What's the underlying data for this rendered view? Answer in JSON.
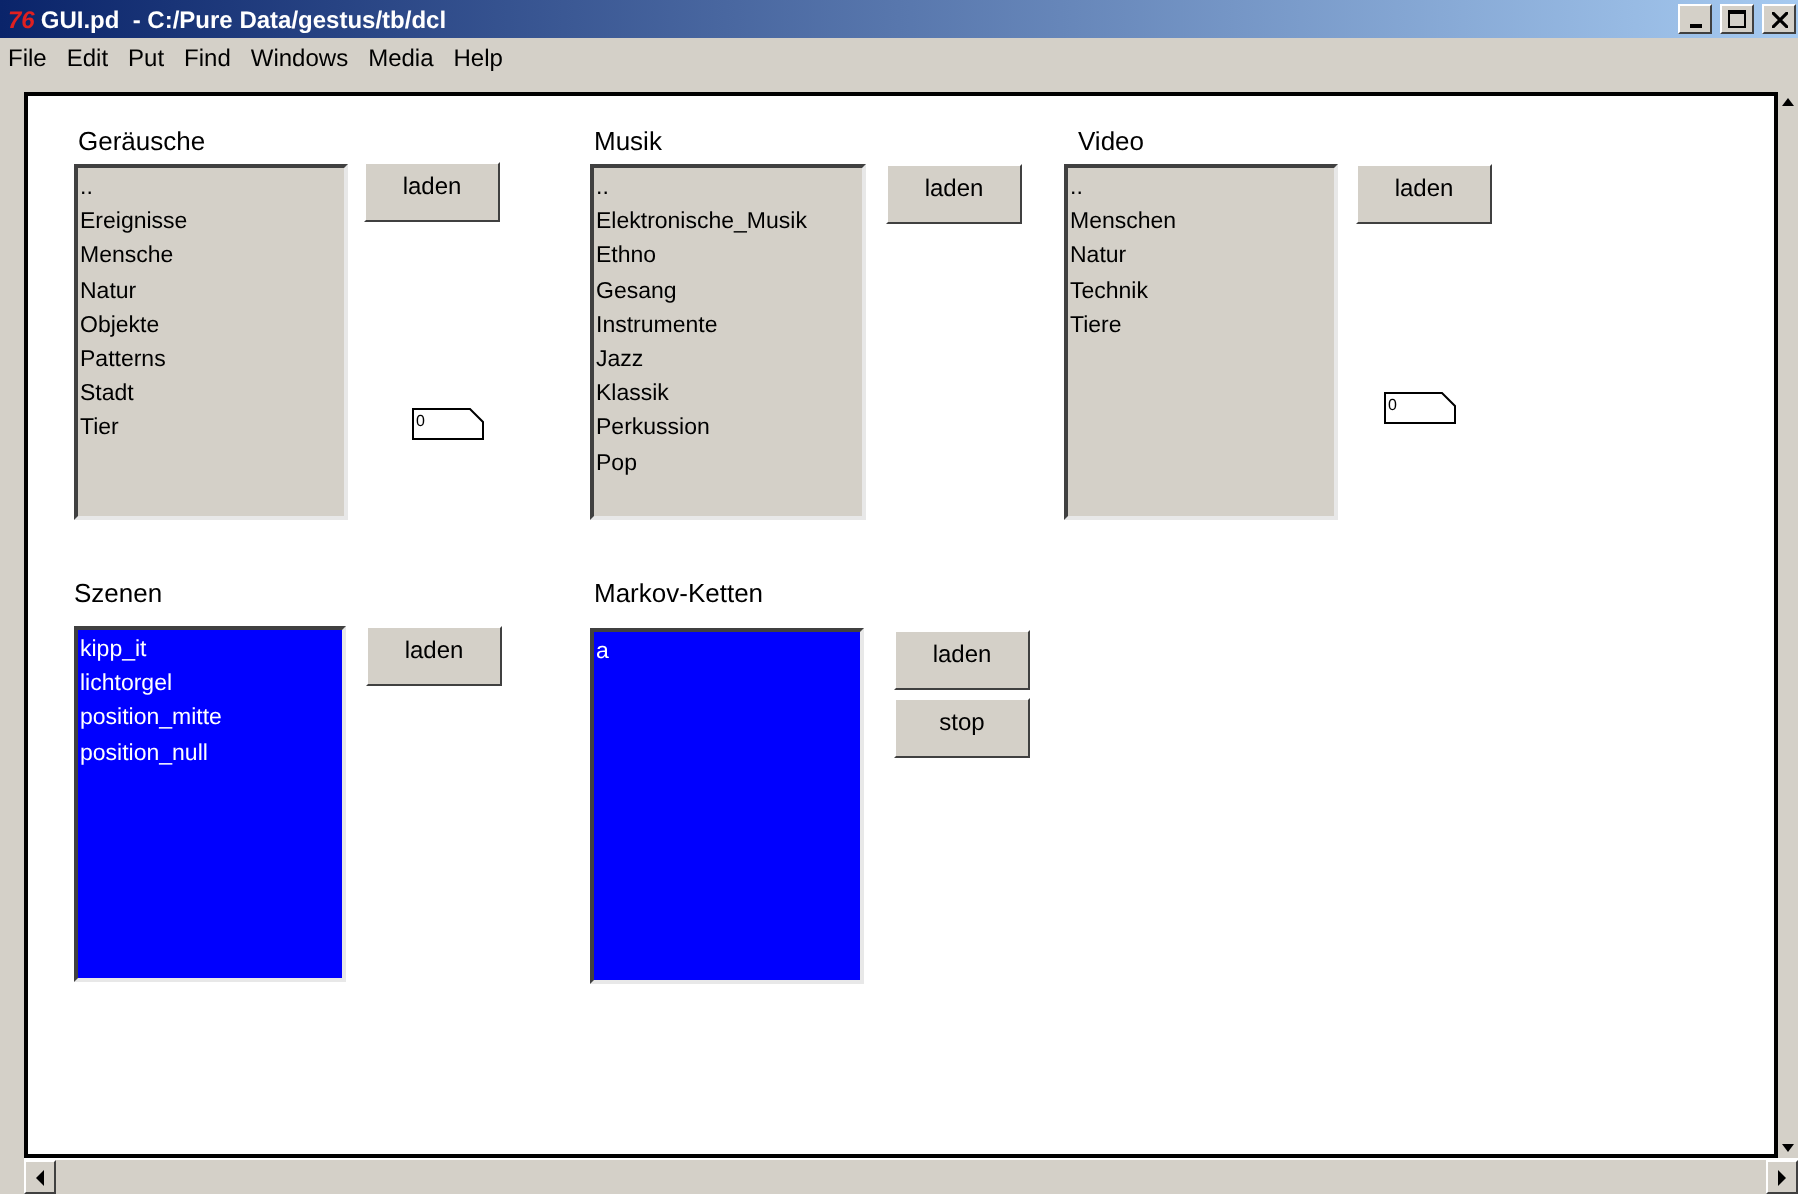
{
  "window": {
    "title": "GUI.pd  - C:/Pure Data/gestus/tb/dcl",
    "logo": "76"
  },
  "menu": [
    "File",
    "Edit",
    "Put",
    "Find",
    "Windows",
    "Media",
    "Help"
  ],
  "panels": [
    {
      "label": "Geräusche",
      "color": "#d4d0c8",
      "items": [
        "..",
        "Ereignisse",
        "Mensche",
        "Natur",
        "Objekte",
        "Patterns",
        "Stadt",
        "Tier"
      ],
      "buttons": [
        "laden"
      ],
      "number": "0"
    },
    {
      "label": "Musik",
      "color": "#d4d0c8",
      "items": [
        "..",
        "Elektronische_Musik",
        "Ethno",
        "Gesang",
        "Instrumente",
        "Jazz",
        "Klassik",
        "Perkussion",
        "Pop"
      ],
      "buttons": [
        "laden"
      ]
    },
    {
      "label": "Video",
      "color": "#d4d0c8",
      "items": [
        "..",
        "Menschen",
        "Natur",
        "Technik",
        "Tiere"
      ],
      "buttons": [
        "laden"
      ],
      "number": "0"
    },
    {
      "label": "Szenen",
      "color": "#0000ff",
      "items": [
        "kipp_it",
        "lichtorgel",
        "position_mitte",
        "position_null"
      ],
      "buttons": [
        "laden"
      ]
    },
    {
      "label": "Markov-Ketten",
      "color": "#0000ff",
      "items": [
        "a"
      ],
      "buttons": [
        "laden",
        "stop"
      ]
    }
  ]
}
